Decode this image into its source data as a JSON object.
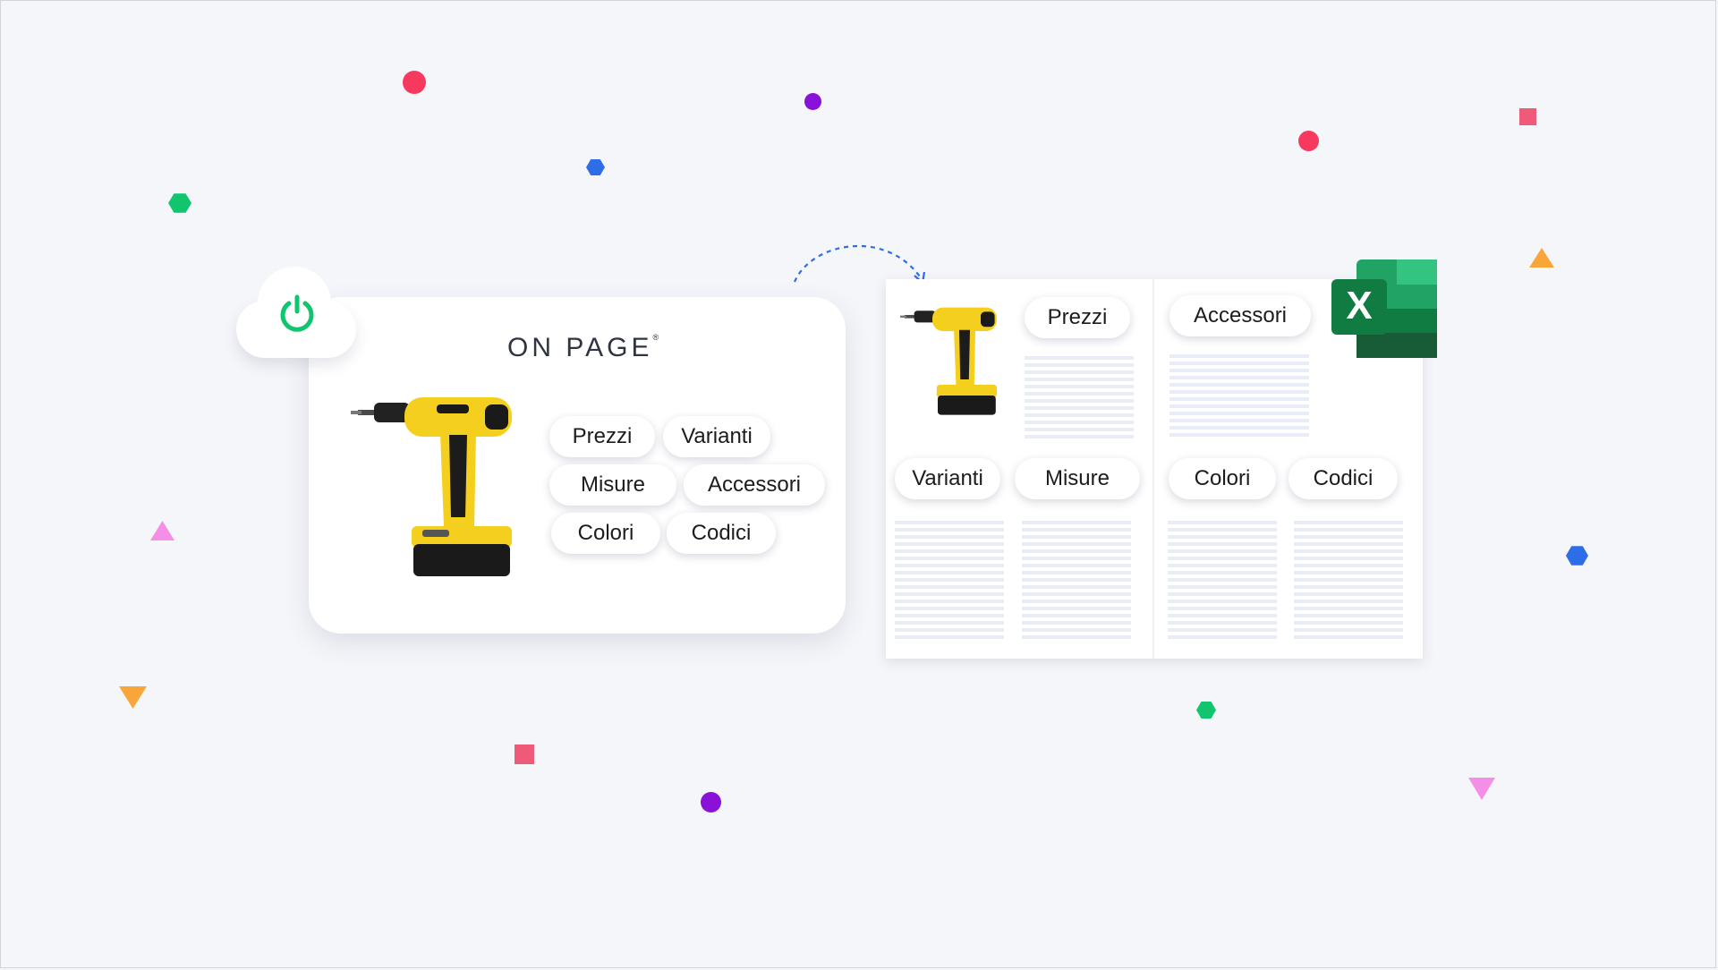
{
  "logo": {
    "name": "ON PAGE",
    "reg": "®"
  },
  "card_tags": [
    "Prezzi",
    "Varianti",
    "Misure",
    "Accessori",
    "Colori",
    "Codici"
  ],
  "sheet_tags": {
    "prezzi": "Prezzi",
    "accessori": "Accessori",
    "varianti": "Varianti",
    "misure": "Misure",
    "colori": "Colori",
    "codici": "Codici"
  },
  "excel": {
    "letter": "X"
  },
  "colors": {
    "pink": "#f7385f",
    "purple": "#8a12d8",
    "blue": "#2d6ee8",
    "green": "#11c46e",
    "orange": "#f8a63a",
    "lilac": "#f48ee6",
    "excel_dark": "#185c37",
    "excel_mid": "#21a366",
    "excel_light": "#33c481"
  },
  "icons": [
    "power-icon",
    "drill-image",
    "excel-icon",
    "dashed-arrow-icon"
  ]
}
